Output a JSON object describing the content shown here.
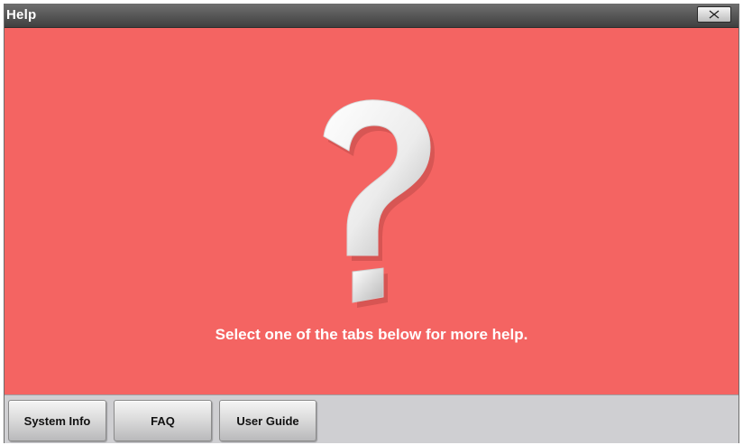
{
  "window": {
    "title": "Help",
    "close_icon": "close-x-icon"
  },
  "content": {
    "background_color": "#f46462",
    "icon": "question-mark-icon",
    "message": "Select one of the tabs below for more help."
  },
  "tabs": [
    {
      "label": "System Info"
    },
    {
      "label": "FAQ"
    },
    {
      "label": "User Guide"
    }
  ]
}
